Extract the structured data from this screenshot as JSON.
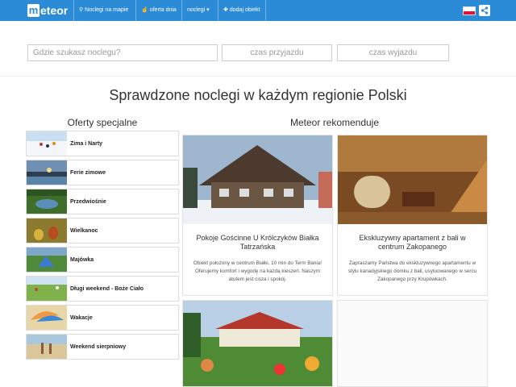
{
  "nav": {
    "logo_m": "m",
    "logo_rest": "eteor",
    "items": [
      {
        "icon": "map-marker-icon",
        "glyph": "⚲",
        "label": "Noclegi na mapie"
      },
      {
        "icon": "thumbs-up-icon",
        "glyph": "👍",
        "label": "oferta dnia"
      },
      {
        "icon": "caret-down-icon",
        "glyph": "▾",
        "label": "noclegi"
      },
      {
        "icon": "plus-icon",
        "glyph": "✚",
        "label": "dodaj obiekt"
      }
    ],
    "flag_colors": {
      "top": "#ffffff",
      "bottom": "#dc143c"
    },
    "share_icon": "share-icon",
    "brand_color": "#2b8bd6"
  },
  "search": {
    "where_placeholder": "Gdzie szukasz noclegu?",
    "arrival_placeholder": "czas przyjazdu",
    "departure_placeholder": "czas wyjazdu"
  },
  "main": {
    "title": "Sprawdzone noclegi w każdym regionie Polski"
  },
  "offers": {
    "heading": "Oferty specjalne",
    "items": [
      {
        "label": "Zima i Narty"
      },
      {
        "label": "Ferie zimowe"
      },
      {
        "label": "Przedwiośnie"
      },
      {
        "label": "Wielkanoc"
      },
      {
        "label": "Majówka"
      },
      {
        "label": "Długi weekend - Boże Ciało"
      },
      {
        "label": "Wakacje"
      },
      {
        "label": "Weekend sierpniowy"
      }
    ]
  },
  "recommend": {
    "heading": "Meteor rekomenduje",
    "cards": [
      {
        "title": "Pokoje Gościnne U Królczyków Białka Tatrzańska",
        "desc": "Obiekt położony w centrum Białki, 10 min do Term Bania! Oferujemy komfort i wygodę na każdą kieszeń. Naszym atutem jest cisza i spokój."
      },
      {
        "title": "Ekskluzywny apartament z bali w centrum Zakopanego",
        "desc": "Zapraszamy Państwa do ekskluzywnego apartamentu w stylu kanadyjskiego domku z bali, usytuowanego w sercu Zakopanego przy Krupówkach."
      }
    ]
  }
}
